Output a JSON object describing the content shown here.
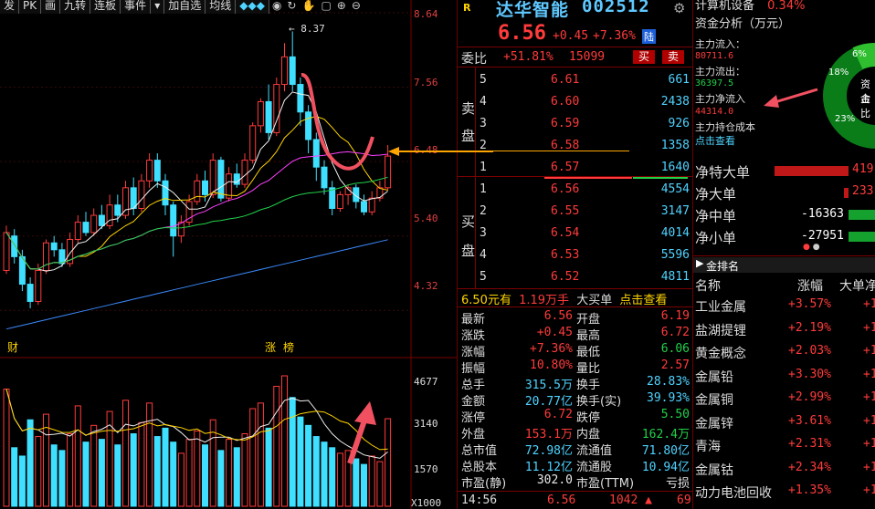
{
  "toolbar": {
    "items": [
      "发",
      "PK",
      "画",
      "九转",
      "连板",
      "事件",
      "▾",
      "加自选",
      "均线",
      "◆◆◆"
    ],
    "icons": [
      "eye-icon",
      "refresh-icon",
      "hand-icon",
      "square-icon",
      "zoom-in-icon",
      "zoom-out-icon"
    ]
  },
  "chart": {
    "price_ticks": [
      "8.64",
      "7.56",
      "6.48",
      "5.40",
      "4.32"
    ],
    "high_label": "8.37",
    "bottom_labels": [
      "财",
      "涨",
      "榜"
    ],
    "vol_ticks": [
      "4677",
      "3140",
      "1570",
      "X1000"
    ]
  },
  "chart_data": {
    "type": "candlestick",
    "price_axis": {
      "min": 3.9,
      "max": 8.64,
      "ticks": [
        8.64,
        7.56,
        6.48,
        5.4,
        4.32
      ]
    },
    "candles": [
      {
        "o": 4.9,
        "c": 5.45,
        "h": 5.55,
        "l": 4.85
      },
      {
        "o": 5.4,
        "c": 5.1,
        "h": 5.5,
        "l": 5.0
      },
      {
        "o": 5.1,
        "c": 4.7,
        "h": 5.2,
        "l": 4.6
      },
      {
        "o": 4.7,
        "c": 4.45,
        "h": 4.8,
        "l": 4.35
      },
      {
        "o": 4.45,
        "c": 4.9,
        "h": 5.0,
        "l": 4.4
      },
      {
        "o": 4.9,
        "c": 5.3,
        "h": 5.35,
        "l": 4.85
      },
      {
        "o": 5.3,
        "c": 5.2,
        "h": 5.4,
        "l": 5.1
      },
      {
        "o": 5.2,
        "c": 5.0,
        "h": 5.3,
        "l": 4.95
      },
      {
        "o": 5.0,
        "c": 5.35,
        "h": 5.45,
        "l": 4.95
      },
      {
        "o": 5.35,
        "c": 5.6,
        "h": 5.7,
        "l": 5.3
      },
      {
        "o": 5.6,
        "c": 5.45,
        "h": 5.75,
        "l": 5.4
      },
      {
        "o": 5.45,
        "c": 5.7,
        "h": 5.8,
        "l": 5.4
      },
      {
        "o": 5.7,
        "c": 5.55,
        "h": 5.85,
        "l": 5.5
      },
      {
        "o": 5.55,
        "c": 5.85,
        "h": 6.0,
        "l": 5.5
      },
      {
        "o": 5.85,
        "c": 5.7,
        "h": 6.0,
        "l": 5.6
      },
      {
        "o": 5.7,
        "c": 6.1,
        "h": 6.2,
        "l": 5.65
      },
      {
        "o": 6.1,
        "c": 5.8,
        "h": 6.25,
        "l": 5.7
      },
      {
        "o": 5.8,
        "c": 6.2,
        "h": 6.3,
        "l": 5.75
      },
      {
        "o": 6.2,
        "c": 6.5,
        "h": 6.6,
        "l": 6.1
      },
      {
        "o": 6.5,
        "c": 6.2,
        "h": 6.6,
        "l": 6.1
      },
      {
        "o": 6.2,
        "c": 5.85,
        "h": 6.3,
        "l": 5.7
      },
      {
        "o": 5.85,
        "c": 5.4,
        "h": 5.9,
        "l": 5.1
      },
      {
        "o": 5.4,
        "c": 5.6,
        "h": 5.7,
        "l": 5.3
      },
      {
        "o": 5.6,
        "c": 5.9,
        "h": 6.0,
        "l": 5.55
      },
      {
        "o": 5.9,
        "c": 6.2,
        "h": 6.3,
        "l": 5.85
      },
      {
        "o": 6.2,
        "c": 6.0,
        "h": 6.35,
        "l": 5.9
      },
      {
        "o": 6.0,
        "c": 6.5,
        "h": 6.6,
        "l": 5.95
      },
      {
        "o": 6.5,
        "c": 5.95,
        "h": 6.55,
        "l": 5.9
      },
      {
        "o": 5.95,
        "c": 6.3,
        "h": 6.4,
        "l": 5.9
      },
      {
        "o": 6.3,
        "c": 6.15,
        "h": 6.45,
        "l": 6.1
      },
      {
        "o": 6.15,
        "c": 6.5,
        "h": 6.6,
        "l": 6.1
      },
      {
        "o": 6.5,
        "c": 7.0,
        "h": 7.05,
        "l": 6.45
      },
      {
        "o": 7.0,
        "c": 7.35,
        "h": 7.4,
        "l": 6.9
      },
      {
        "o": 7.35,
        "c": 6.9,
        "h": 7.6,
        "l": 6.8
      },
      {
        "o": 6.9,
        "c": 7.6,
        "h": 7.7,
        "l": 6.85
      },
      {
        "o": 7.6,
        "c": 8.0,
        "h": 8.2,
        "l": 7.5
      },
      {
        "o": 8.0,
        "c": 7.6,
        "h": 8.37,
        "l": 7.5
      },
      {
        "o": 7.6,
        "c": 7.2,
        "h": 7.7,
        "l": 7.0
      },
      {
        "o": 7.2,
        "c": 6.8,
        "h": 7.3,
        "l": 6.6
      },
      {
        "o": 6.8,
        "c": 6.4,
        "h": 6.9,
        "l": 6.2
      },
      {
        "o": 6.4,
        "c": 6.1,
        "h": 6.5,
        "l": 6.0
      },
      {
        "o": 6.1,
        "c": 5.8,
        "h": 6.2,
        "l": 5.7
      },
      {
        "o": 5.8,
        "c": 6.0,
        "h": 6.05,
        "l": 5.75
      },
      {
        "o": 6.0,
        "c": 6.1,
        "h": 6.15,
        "l": 5.85
      },
      {
        "o": 6.1,
        "c": 5.9,
        "h": 6.15,
        "l": 5.8
      },
      {
        "o": 5.9,
        "c": 5.75,
        "h": 6.0,
        "l": 5.7
      },
      {
        "o": 5.75,
        "c": 5.95,
        "h": 6.05,
        "l": 5.7
      },
      {
        "o": 5.95,
        "c": 6.1,
        "h": 6.2,
        "l": 5.9
      },
      {
        "o": 6.1,
        "c": 6.56,
        "h": 6.72,
        "l": 6.06
      }
    ],
    "volume_axis": {
      "max": 4677,
      "ticks": [
        4677,
        3140,
        1570
      ]
    },
    "volumes": [
      4200,
      2100,
      1800,
      3100,
      2500,
      3300,
      2200,
      2000,
      2600,
      3600,
      2300,
      2900,
      2400,
      3400,
      2200,
      3800,
      2600,
      3000,
      3700,
      2500,
      2800,
      2300,
      1900,
      2400,
      2700,
      2200,
      3100,
      2000,
      2400,
      2100,
      2600,
      3500,
      3700,
      2800,
      4300,
      4677,
      3900,
      3200,
      2900,
      2500,
      2300,
      2100,
      1900,
      2000,
      1700,
      1500,
      1800,
      1600,
      3140
    ]
  },
  "quote": {
    "name": "达华智能",
    "code": "002512",
    "price": "6.56",
    "change": "+0.45",
    "change_pct": "+7.36%",
    "board_tag": "陆",
    "r_tag": "R",
    "weibi_label": "委比",
    "weibi_pct": "+51.81%",
    "weibi_diff": "15099",
    "buy_btn": "买",
    "sell_btn": "卖",
    "sell_label": [
      "卖",
      "盘"
    ],
    "buy_label": [
      "买",
      "盘"
    ],
    "asks": [
      {
        "n": "5",
        "p": "6.61",
        "v": "661"
      },
      {
        "n": "4",
        "p": "6.60",
        "v": "2438"
      },
      {
        "n": "3",
        "p": "6.59",
        "v": "926"
      },
      {
        "n": "2",
        "p": "6.58",
        "v": "1358"
      },
      {
        "n": "1",
        "p": "6.57",
        "v": "1640"
      }
    ],
    "bids": [
      {
        "n": "1",
        "p": "6.56",
        "v": "4554"
      },
      {
        "n": "2",
        "p": "6.55",
        "v": "3147"
      },
      {
        "n": "3",
        "p": "6.54",
        "v": "4014"
      },
      {
        "n": "4",
        "p": "6.53",
        "v": "5596"
      },
      {
        "n": "5",
        "p": "6.52",
        "v": "4811"
      }
    ],
    "bigorder": {
      "price": "6.50元有",
      "amount": "1.19万手",
      "label": "大买单",
      "link": "点击查看"
    },
    "stats": [
      {
        "k1": "最新",
        "v1": "6.56",
        "c1": "red",
        "k2": "开盘",
        "v2": "6.19",
        "c2": "red"
      },
      {
        "k1": "涨跌",
        "v1": "+0.45",
        "c1": "red",
        "k2": "最高",
        "v2": "6.72",
        "c2": "red"
      },
      {
        "k1": "涨幅",
        "v1": "+7.36%",
        "c1": "red",
        "k2": "最低",
        "v2": "6.06",
        "c2": "grn"
      },
      {
        "k1": "振幅",
        "v1": "10.80%",
        "c1": "red",
        "k2": "量比",
        "v2": "2.57",
        "c2": "red"
      },
      {
        "k1": "总手",
        "v1": "315.5万",
        "c1": "cyn",
        "k2": "换手",
        "v2": "28.83%",
        "c2": "cyn"
      },
      {
        "k1": "金额",
        "v1": "20.77亿",
        "c1": "cyn",
        "k2": "换手(实)",
        "v2": "39.93%",
        "c2": "cyn"
      },
      {
        "k1": "涨停",
        "v1": "6.72",
        "c1": "red",
        "k2": "跌停",
        "v2": "5.50",
        "c2": "grn"
      },
      {
        "k1": "外盘",
        "v1": "153.1万",
        "c1": "red",
        "k2": "内盘",
        "v2": "162.4万",
        "c2": "grn"
      },
      {
        "k1": "总市值",
        "v1": "72.98亿",
        "c1": "cyn",
        "k2": "流通值",
        "v2": "71.80亿",
        "c2": "cyn"
      },
      {
        "k1": "总股本",
        "v1": "11.12亿",
        "c1": "cyn",
        "k2": "流通股",
        "v2": "10.94亿",
        "c2": "cyn"
      },
      {
        "k1": "市盈(静)",
        "v1": "302.0",
        "c1": "wht",
        "k2": "市盈(TTM)",
        "v2": "亏损",
        "c2": "wht"
      }
    ],
    "tick": {
      "time": "14:56",
      "price": "6.56",
      "vol": "1042",
      "extra": "69"
    }
  },
  "right": {
    "top_sector": "计算机设备",
    "top_sector_pct": "0.34%",
    "fund_title": "资金分析（万元）",
    "inflow_label": "主力流入：",
    "inflow_val": "80711.6",
    "outflow_label": "主力流出：",
    "outflow_val": "36397.5",
    "net_label": "主力净流入",
    "net_val": "44314.0",
    "cost_label": "主力持仓成本",
    "cost_link": "点击查看",
    "donut": {
      "pct_a": "18%",
      "pct_b": "6%",
      "pct_c": "23%",
      "center1": "资金",
      "center2": "占比",
      "share_green": 0.47,
      "share_red": 0.53
    },
    "flows": [
      {
        "label": "净特大单",
        "val": "419",
        "dir": "pos",
        "frac": 0.9
      },
      {
        "label": "净大单",
        "val": "233",
        "dir": "pos",
        "frac": 0.05
      },
      {
        "label": "净中单",
        "val": "-16363",
        "dir": "neg",
        "frac": 0.35
      },
      {
        "label": "净小单",
        "val": "-27951",
        "dir": "neg",
        "frac": 0.6
      }
    ],
    "sector_tab": "金排名",
    "sector_cols": [
      "名称",
      "涨幅",
      "大单净"
    ],
    "sectors": [
      {
        "name": "工业金属",
        "pct": "+3.57%",
        "extra": "+1"
      },
      {
        "name": "盐湖提锂",
        "pct": "+2.19%",
        "extra": "+1"
      },
      {
        "name": "黄金概念",
        "pct": "+2.03%",
        "extra": "+1"
      },
      {
        "name": "金属铅",
        "pct": "+3.30%",
        "extra": "+1"
      },
      {
        "name": "金属铜",
        "pct": "+2.99%",
        "extra": "+1"
      },
      {
        "name": "金属锌",
        "pct": "+3.61%",
        "extra": "+1"
      },
      {
        "name": "青海",
        "pct": "+2.31%",
        "extra": "+1"
      },
      {
        "name": "金属钴",
        "pct": "+2.34%",
        "extra": "+1"
      },
      {
        "name": "动力电池回收",
        "pct": "+1.35%",
        "extra": "+1"
      }
    ]
  }
}
